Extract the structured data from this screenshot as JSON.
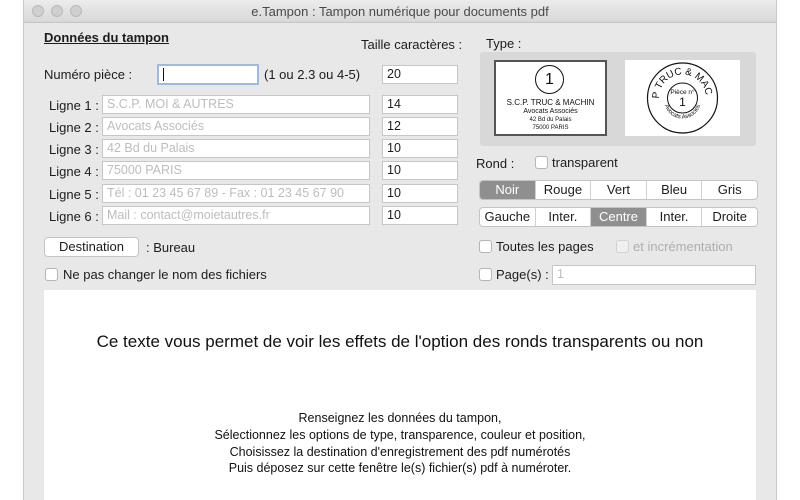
{
  "window": {
    "title": "e.Tampon : Tampon numérique pour documents pdf"
  },
  "left": {
    "section_title": "Données du tampon",
    "size_header": "Taille caractères :",
    "piece_label": "Numéro pièce :",
    "piece_value": "",
    "piece_hint": "(1 ou 2.3 ou 4-5)",
    "piece_size": "20",
    "lines": [
      {
        "label": "Ligne 1 :",
        "value": "S.C.P. MOI & AUTRES",
        "size": "14"
      },
      {
        "label": "Ligne 2 :",
        "value": "Avocats Associés",
        "size": "12"
      },
      {
        "label": "Ligne 3 :",
        "value": "42 Bd du Palais",
        "size": "10"
      },
      {
        "label": "Ligne 4 :",
        "value": "75000 PARIS",
        "size": "10"
      },
      {
        "label": "Ligne 5 :",
        "value": "Tél : 01 23 45 67 89 - Fax : 01 23 45 67 90",
        "size": "10"
      },
      {
        "label": "Ligne 6 :",
        "value": "Mail : contact@moietautres.fr",
        "size": "10"
      }
    ],
    "destination_button": "Destination",
    "destination_value": ": Bureau",
    "keep_names_label": "Ne pas changer le nom des fichiers"
  },
  "right": {
    "type_label": "Type :",
    "stamp_rect": {
      "number": "1",
      "line1": "S.C.P. TRUC & MACHIN",
      "line2": "Avocats Associés",
      "line3": "42 Bd du Palais",
      "line4": "75000 PARIS"
    },
    "stamp_round": {
      "top_text": "SCP TRUC & MACHIN",
      "piece": "Pièce n°",
      "number": "1",
      "bottom_text": "Avocats Associés"
    },
    "rond_label": "Rond :",
    "transparent_label": "transparent",
    "colors": [
      "Noir",
      "Rouge",
      "Vert",
      "Bleu",
      "Gris"
    ],
    "color_selected": "Noir",
    "positions": [
      "Gauche",
      "Inter.",
      "Centre",
      "Inter.",
      "Droite"
    ],
    "position_selected": "Centre",
    "all_pages_label": "Toutes les pages",
    "increment_label": "et incrémentation",
    "pages_label": "Page(s) :",
    "pages_placeholder": "1"
  },
  "preview": {
    "headline": "Ce texte vous permet de voir les effets de l'option des ronds transparents ou non",
    "instructions": [
      "Renseignez les données du tampon,",
      "Sélectionnez les options de type, transparence, couleur et position,",
      "Choisissez la destination d'enregistrement des pdf numérotés",
      "Puis déposez sur cette fenêtre le(s) fichier(s) pdf à numéroter."
    ]
  }
}
